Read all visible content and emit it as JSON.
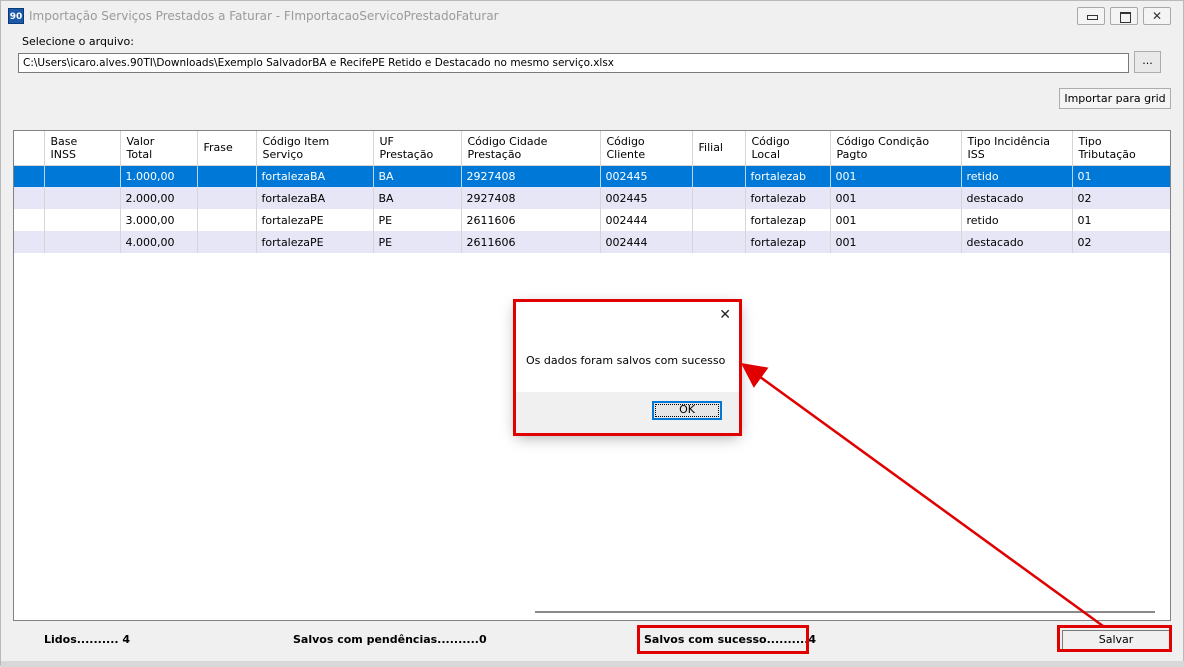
{
  "window": {
    "icon_text": "90",
    "title": "Importação Serviços Prestados a Faturar - FImportacaoServicoPrestadoFaturar"
  },
  "file": {
    "label": "Selecione o arquivo:",
    "path": "C:\\Users\\icaro.alves.90TI\\Downloads\\Exemplo SalvadorBA e RecifePE Retido e Destacado no mesmo serviço.xlsx",
    "browse_label": "..."
  },
  "import_button": "Importar para grid",
  "grid": {
    "headers": [
      [
        "",
        ""
      ],
      [
        "Base",
        "INSS"
      ],
      [
        "Valor",
        "Total"
      ],
      [
        "Frase",
        ""
      ],
      [
        "Código Item",
        "Serviço"
      ],
      [
        "UF",
        "Prestação"
      ],
      [
        "Código Cidade",
        "Prestação"
      ],
      [
        "Código",
        "Cliente"
      ],
      [
        "Filial",
        ""
      ],
      [
        "Código",
        "Local"
      ],
      [
        "Código Condição",
        "Pagto"
      ],
      [
        "Tipo Incidência",
        "ISS"
      ],
      [
        "Tipo",
        "Tributação"
      ]
    ],
    "rows": [
      [
        "",
        "",
        "1.000,00",
        "",
        "fortalezaBA",
        "BA",
        "2927408",
        "002445",
        "",
        "fortalezab",
        "001",
        "retido",
        "01"
      ],
      [
        "",
        "",
        "2.000,00",
        "",
        "fortalezaBA",
        "BA",
        "2927408",
        "002445",
        "",
        "fortalezab",
        "001",
        "destacado",
        "02"
      ],
      [
        "",
        "",
        "3.000,00",
        "",
        "fortalezaPE",
        "PE",
        "2611606",
        "002444",
        "",
        "fortalezap",
        "001",
        "retido",
        "01"
      ],
      [
        "",
        "",
        "4.000,00",
        "",
        "fortalezaPE",
        "PE",
        "2611606",
        "002444",
        "",
        "fortalezap",
        "001",
        "destacado",
        "02"
      ]
    ],
    "selected_row": 0
  },
  "status": {
    "lidos": "Lidos.......... 4",
    "pendencias": "Salvos com pendências..........0",
    "sucesso": "Salvos com sucesso..........4"
  },
  "save_button": "Salvar",
  "dialog": {
    "close_glyph": "✕",
    "message": "Os dados foram salvos com sucesso",
    "ok_label": "OK"
  },
  "colors": {
    "selection": "#0078d7",
    "annotation": "#e00000"
  }
}
